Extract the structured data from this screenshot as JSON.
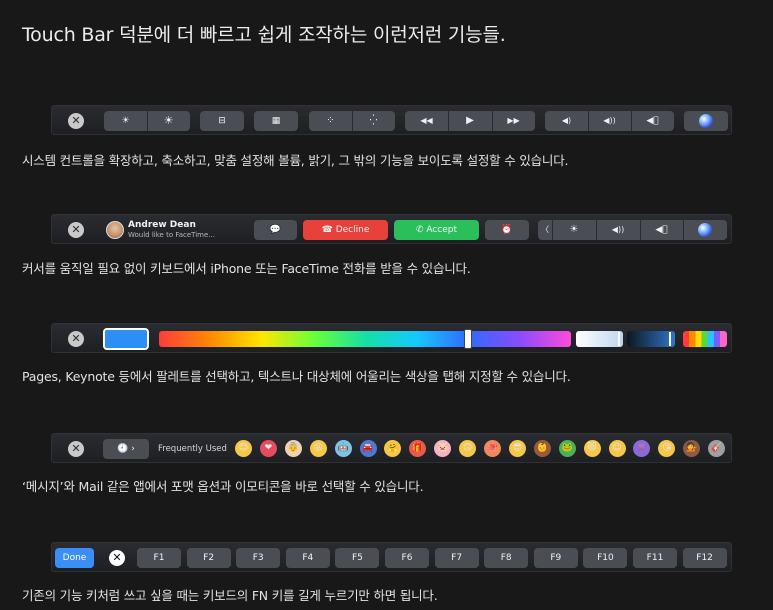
{
  "title": "Touch Bar 덕분에 더 빠르고 쉽게 조작하는 이런저런 기능들.",
  "captions": [
    "시스템 컨트롤을 확장하고, 축소하고, 맞춤 설정해 볼륨, 밝기, 그 밖의 기능을 보이도록 설정할 수 있습니다.",
    "커서를 움직일 필요 없이 키보드에서 iPhone 또는 FaceTime 전화를 받을 수 있습니다.",
    "Pages, Keynote 등에서 팔레트를 선택하고, 텍스트나 대상체에 어울리는 색상을 탭해 지정할 수 있습니다.",
    "‘메시지’와 Mail 같은 앱에서 포맷 옵션과 이모티콘을 바로 선택할 수 있습니다.",
    "기존의 기능 키처럼 쓰고 싶을 때는 키보드의 FN 키를 길게 누르기만 하면 됩니다."
  ],
  "bar1": {
    "esc": "✕",
    "icons": [
      "brightness-down-icon",
      "brightness-up-icon",
      "mission-control-icon",
      "launchpad-icon",
      "keyboard-light-down-icon",
      "keyboard-light-up-icon",
      "rewind-icon",
      "play-icon",
      "fast-forward-icon",
      "volume-down-icon",
      "volume-up-icon",
      "mute-icon",
      "siri-icon"
    ],
    "glyphs": {
      "bright_down": "☀",
      "bright_up": "☀",
      "mission": "⊟",
      "launchpad": "▦",
      "kb_down": "⁘",
      "kb_up": "⁛",
      "rewind": "◀◀",
      "play": "▶",
      "ffwd": "▶▶",
      "vol_down": "◀)",
      "vol_up": "◀))",
      "mute": "◀⃠"
    }
  },
  "bar2": {
    "esc": "✕",
    "caller_name": "Andrew Dean",
    "caller_sub": "Would like to FaceTime...",
    "message_glyph": "💬",
    "decline_label": "Decline",
    "accept_label": "Accept",
    "decline_glyph": "☎",
    "accept_glyph": "✆",
    "alarm_glyph": "⏰",
    "collapse_glyph": "〈",
    "brightness_glyph": "☀",
    "vol_up_glyph": "◀))",
    "mute_glyph": "◀⃠",
    "colors": {
      "decline": "#e8413b",
      "accept": "#2bbf5c"
    }
  },
  "bar3": {
    "esc": "✕",
    "selected_color": "#2b8ff3",
    "hue_slider_value": 0.75
  },
  "bar4": {
    "esc": "✕",
    "clock_glyph": "🕘",
    "chevron": "›",
    "frequently_used": "Frequently Used",
    "emojis": [
      "😊",
      "❤",
      "👵",
      "😜",
      "🤖",
      "🚘",
      "🤗",
      "🎁",
      "🐷",
      "🙃",
      "🐙",
      "😎",
      "👶",
      "🐸",
      "😻",
      "😉",
      "👾",
      "😘",
      "💁",
      "🎸"
    ]
  },
  "bar5": {
    "done_label": "Done",
    "esc": "✕",
    "fkeys": [
      "F1",
      "F2",
      "F3",
      "F4",
      "F5",
      "F6",
      "F7",
      "F8",
      "F9",
      "F10",
      "F11",
      "F12"
    ]
  }
}
